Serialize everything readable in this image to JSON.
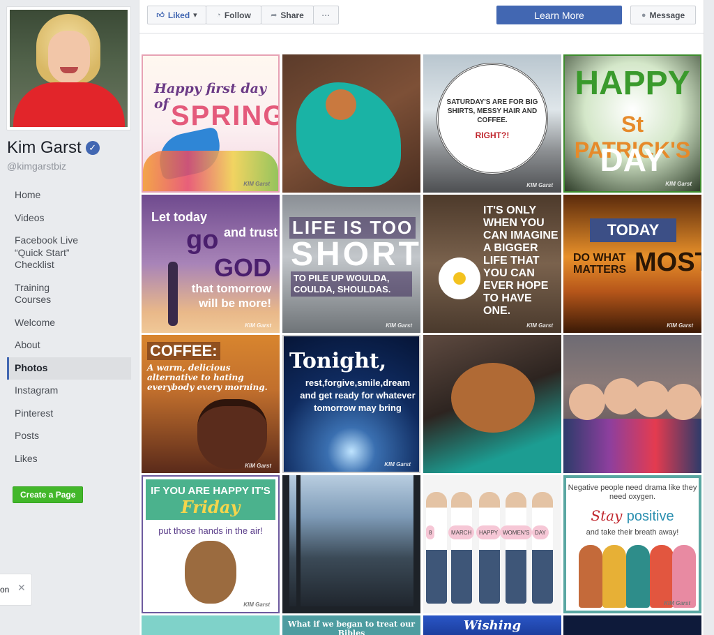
{
  "page": {
    "name": "Kim Garst",
    "handle": "@kimgarstbiz",
    "verified_icon": "verified-check-icon"
  },
  "sidebar": {
    "items": [
      {
        "label": "Home"
      },
      {
        "label": "Videos"
      },
      {
        "label": "Facebook Live “Quick Start” Checklist"
      },
      {
        "label": "Training Courses"
      },
      {
        "label": "Welcome"
      },
      {
        "label": "About"
      },
      {
        "label": "Photos",
        "active": true
      },
      {
        "label": "Instagram"
      },
      {
        "label": "Pinterest"
      },
      {
        "label": "Posts"
      },
      {
        "label": "Likes"
      }
    ],
    "create_page": "Create a Page"
  },
  "popup": {
    "text": "on",
    "close": "✕"
  },
  "actions": {
    "liked": "Liked",
    "follow": "Follow",
    "share": "Share",
    "more": "···",
    "learn_more": "Learn More",
    "message": "Message"
  },
  "colors": {
    "brand": "#4267b2",
    "create_page_green": "#42b72a",
    "background": "#e9ebee"
  },
  "photos": {
    "spring": {
      "l1": "Happy first day of",
      "l2": "SPRING"
    },
    "saturday": {
      "main": "SATURDAY'S ARE FOR BIG SHIRTS, MESSY HAIR AND COFFEE.",
      "right": "RIGHT?!"
    },
    "patrick": {
      "a": "HAPPY",
      "b": "St PATRICK'S",
      "c": "DAY"
    },
    "god": {
      "a": "Let today",
      "b": "go",
      "c": "and trust",
      "d": "GOD",
      "e": "that tomorrow will be more!"
    },
    "life": {
      "a": "LIFE IS TOO",
      "b": "SHORT",
      "c": "TO PILE UP WOULDA, COULDA, SHOULDAS."
    },
    "daisy": {
      "text": "IT'S ONLY WHEN YOU CAN IMAGINE A BIGGER LIFE THAT YOU CAN EVER HOPE TO HAVE ONE."
    },
    "today": {
      "a": "TODAY",
      "b": "DO WHAT MATTERS",
      "c": "MOST"
    },
    "coffee": {
      "a": "COFFEE:",
      "b": "A warm, delicious alternative to hating everybody every morning."
    },
    "tonight": {
      "a": "Tonight,",
      "b": "rest,forgive,smile,dream and get ready for whatever tomorrow may bring"
    },
    "friday": {
      "a": "IF YOU ARE HAPPY IT'S",
      "b": "Friday",
      "c": "put those hands in the air!"
    },
    "women": {
      "signs": [
        "8",
        "MARCH",
        "HAPPY",
        "WOMEN'S",
        "DAY"
      ]
    },
    "negative": {
      "a": "Negative people need drama like they need oxygen.",
      "b1": "Stay",
      "b2": "positive",
      "c": "and take their breath away!"
    },
    "row5": {
      "b": "What if we began to treat our Bibles",
      "c": "Wishing"
    },
    "watermark": "KIM Garst"
  }
}
